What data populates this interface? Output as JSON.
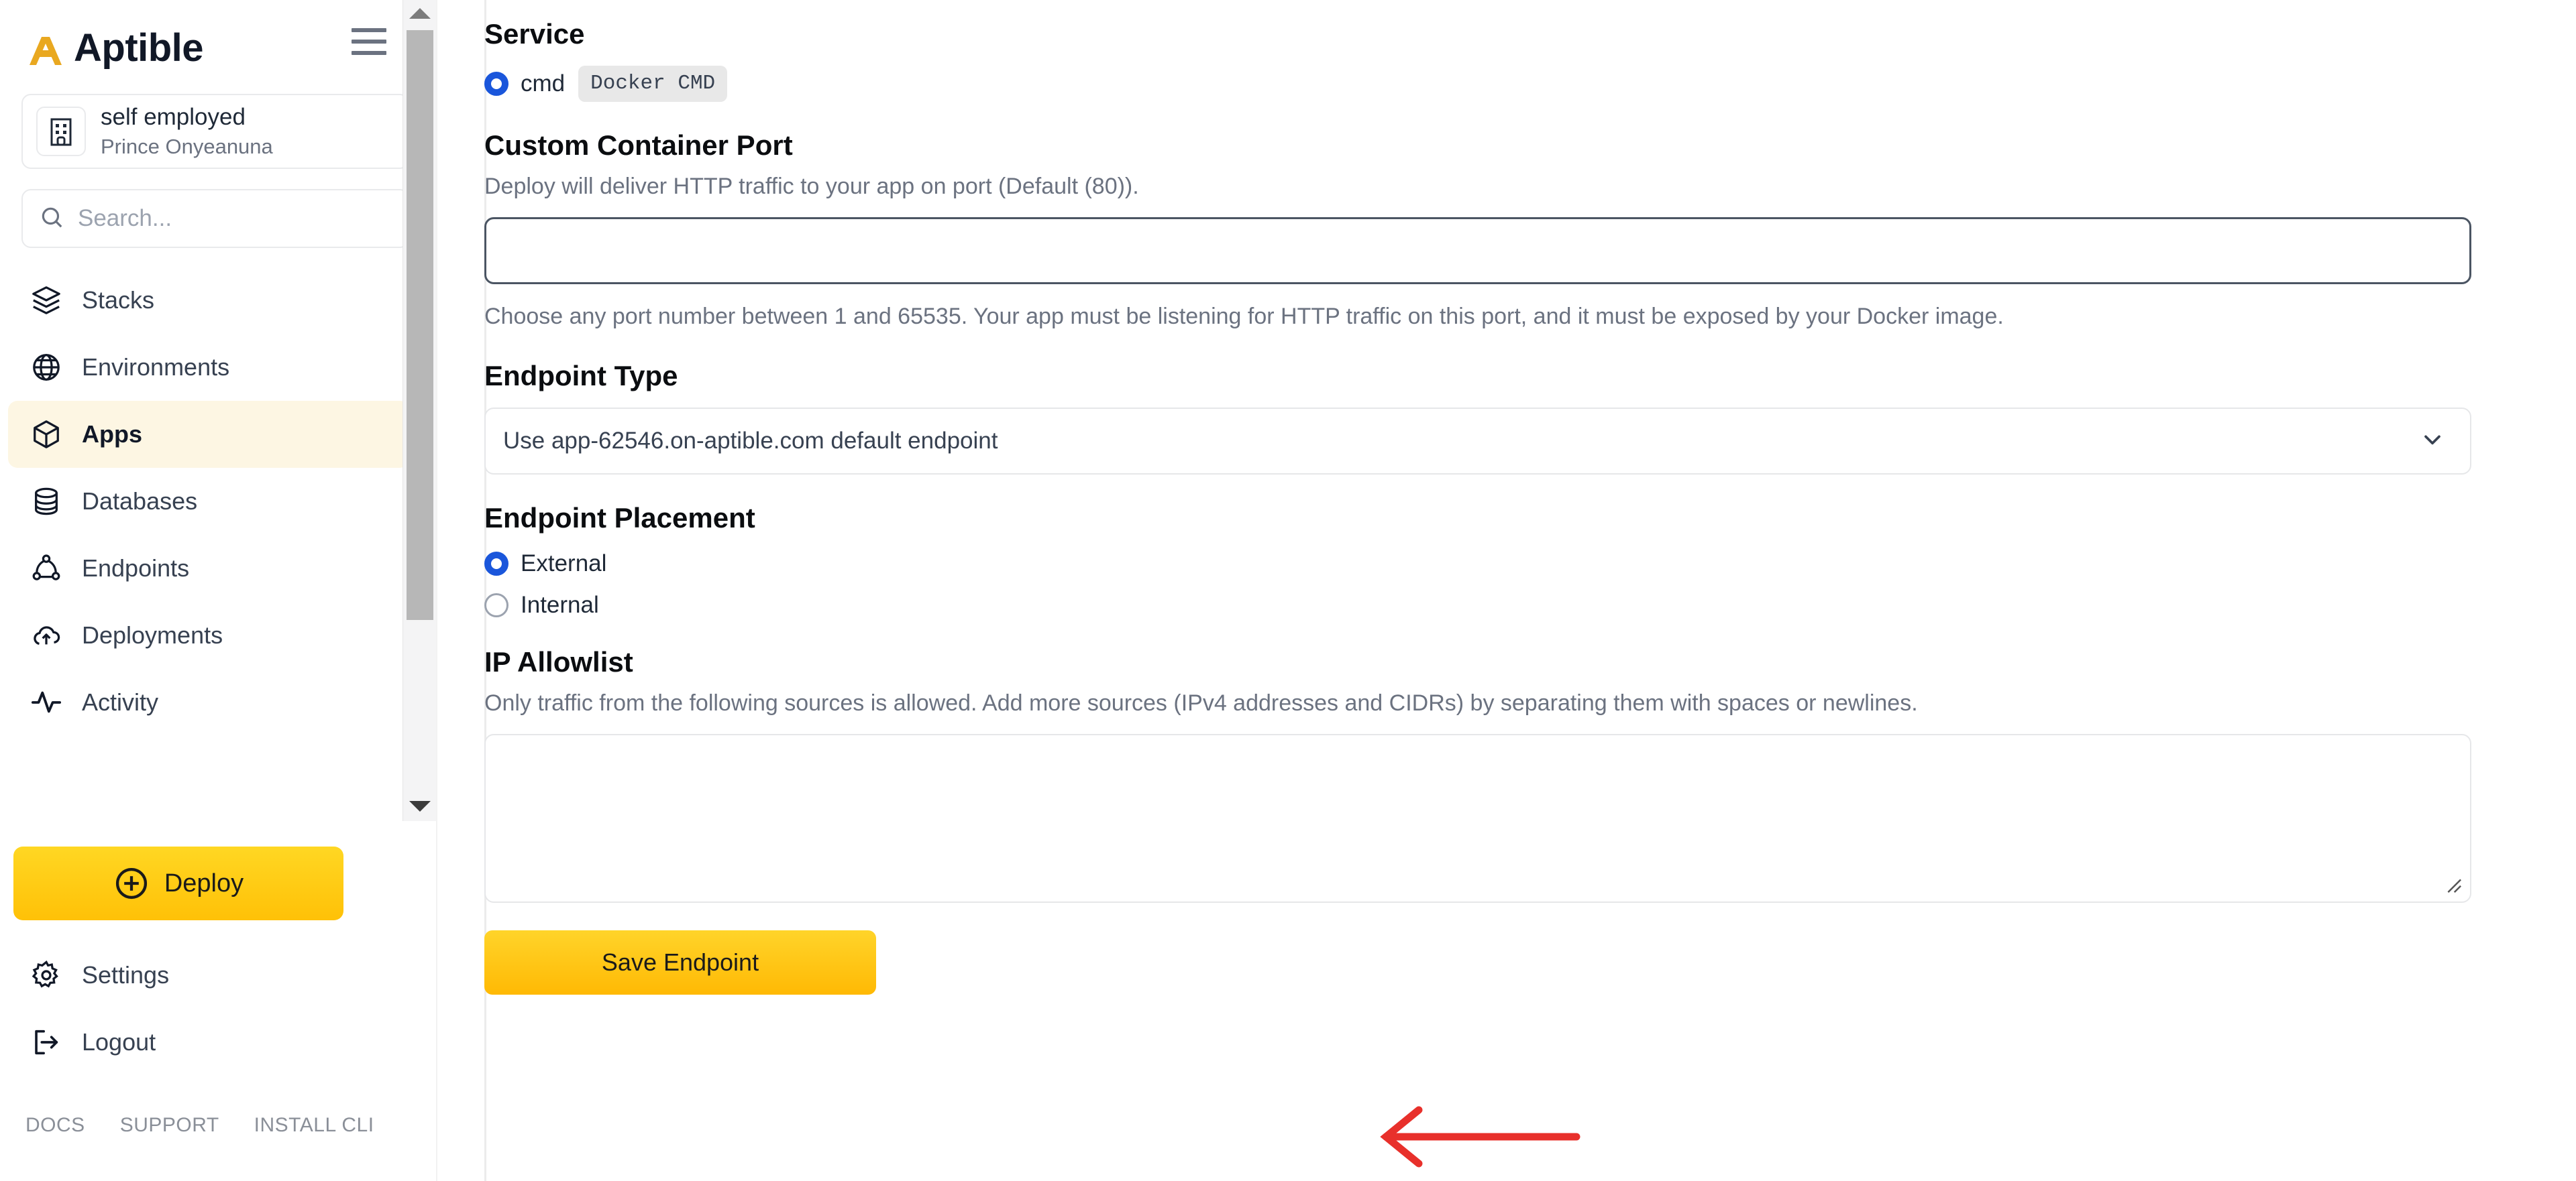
{
  "brand": {
    "name": "Aptible",
    "logo_icon": "aptible-logo-icon",
    "menu_icon": "hamburger-menu-icon"
  },
  "org": {
    "icon": "building-icon",
    "name": "self employed",
    "user": "Prince Onyeanuna"
  },
  "search": {
    "placeholder": "Search...",
    "icon": "search-icon"
  },
  "nav": {
    "items": [
      {
        "label": "Stacks",
        "icon": "layers-icon",
        "active": false
      },
      {
        "label": "Environments",
        "icon": "globe-icon",
        "active": false
      },
      {
        "label": "Apps",
        "icon": "cube-icon",
        "active": true
      },
      {
        "label": "Databases",
        "icon": "database-icon",
        "active": false
      },
      {
        "label": "Endpoints",
        "icon": "endpoints-nodes-icon",
        "active": false
      },
      {
        "label": "Deployments",
        "icon": "cloud-upload-icon",
        "active": false
      },
      {
        "label": "Activity",
        "icon": "activity-pulse-icon",
        "active": false
      }
    ],
    "lower_items": [
      {
        "label": "Settings",
        "icon": "gear-icon"
      },
      {
        "label": "Logout",
        "icon": "logout-icon"
      }
    ]
  },
  "deploy_button": {
    "label": "Deploy",
    "icon": "plus-circle-icon"
  },
  "footer_links": [
    {
      "label": "DOCS"
    },
    {
      "label": "SUPPORT"
    },
    {
      "label": "INSTALL CLI"
    }
  ],
  "form": {
    "service": {
      "title": "Service",
      "radio_label": "cmd",
      "badge": "Docker CMD",
      "checked": true
    },
    "container_port": {
      "title": "Custom Container Port",
      "description": "Deploy will deliver HTTP traffic to your app on port (Default (80)).",
      "value": "",
      "placeholder": "",
      "hint": "Choose any port number between 1 and 65535. Your app must be listening for HTTP traffic on this port, and it must be exposed by your Docker image."
    },
    "endpoint_type": {
      "title": "Endpoint Type",
      "selected": "Use app-62546.on-aptible.com default endpoint",
      "chevron_icon": "chevron-down-icon"
    },
    "endpoint_placement": {
      "title": "Endpoint Placement",
      "options": [
        {
          "label": "External",
          "checked": true
        },
        {
          "label": "Internal",
          "checked": false
        }
      ]
    },
    "ip_allowlist": {
      "title": "IP Allowlist",
      "description": "Only traffic from the following sources is allowed. Add more sources (IPv4 addresses and CIDRs) by separating them with spaces or newlines.",
      "value": "",
      "placeholder": ""
    },
    "save_button": {
      "label": "Save Endpoint"
    }
  },
  "annotation": {
    "arrow_color": "#E8302B",
    "icon": "left-arrow-annotation-icon"
  },
  "colors": {
    "brand_yellow": "#FFC107",
    "accent_blue": "#1A56DB",
    "active_nav_bg": "#FDF6E3",
    "annotation_red": "#E8302B"
  }
}
